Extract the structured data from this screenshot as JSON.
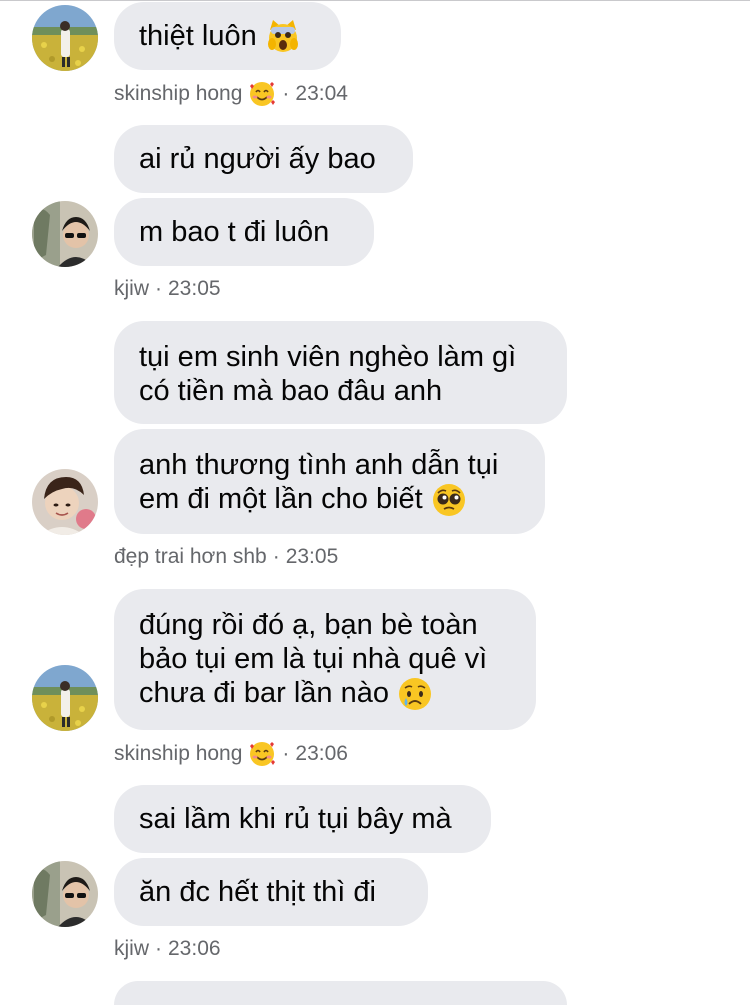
{
  "messages": {
    "m1": {
      "text": "thiệt luôn",
      "emoji": "scream-emoji"
    },
    "meta1": {
      "sender": "skinship hong",
      "emoji": "smiling-face-with-hearts-emoji",
      "time": "23:04"
    },
    "m2": {
      "text": "ai rủ người ấy bao"
    },
    "m3": {
      "text": "m bao t đi luôn"
    },
    "meta2": {
      "sender": "kjiw",
      "time": "23:05"
    },
    "m4": {
      "lines": [
        "tụi em sinh viên nghèo làm gì",
        "có tiền mà bao đâu anh"
      ]
    },
    "m5": {
      "lines": [
        "anh thương tình anh dẫn tụi",
        "em đi một lần cho biết"
      ],
      "emoji": "pleading-face-emoji"
    },
    "meta3": {
      "sender": "đẹp trai hơn shb",
      "time": "23:05"
    },
    "m6": {
      "lines": [
        "đúng rồi đó ạ, bạn bè toàn",
        "bảo tụi em là tụi nhà quê vì",
        "chưa đi bar lần nào"
      ],
      "emoji": "crying-face-emoji"
    },
    "meta4": {
      "sender": "skinship hong",
      "emoji": "smiling-face-with-hearts-emoji",
      "time": "23:06"
    },
    "m7": {
      "text": "sai lầm khi rủ tụi bây mà"
    },
    "m8": {
      "text": "ăn đc hết thịt thì đi"
    },
    "meta5": {
      "sender": "kjiw",
      "time": "23:06"
    }
  },
  "separator": "·",
  "colors": {
    "bubble": "#e9eaee",
    "text": "#050505",
    "meta": "#65676b"
  }
}
